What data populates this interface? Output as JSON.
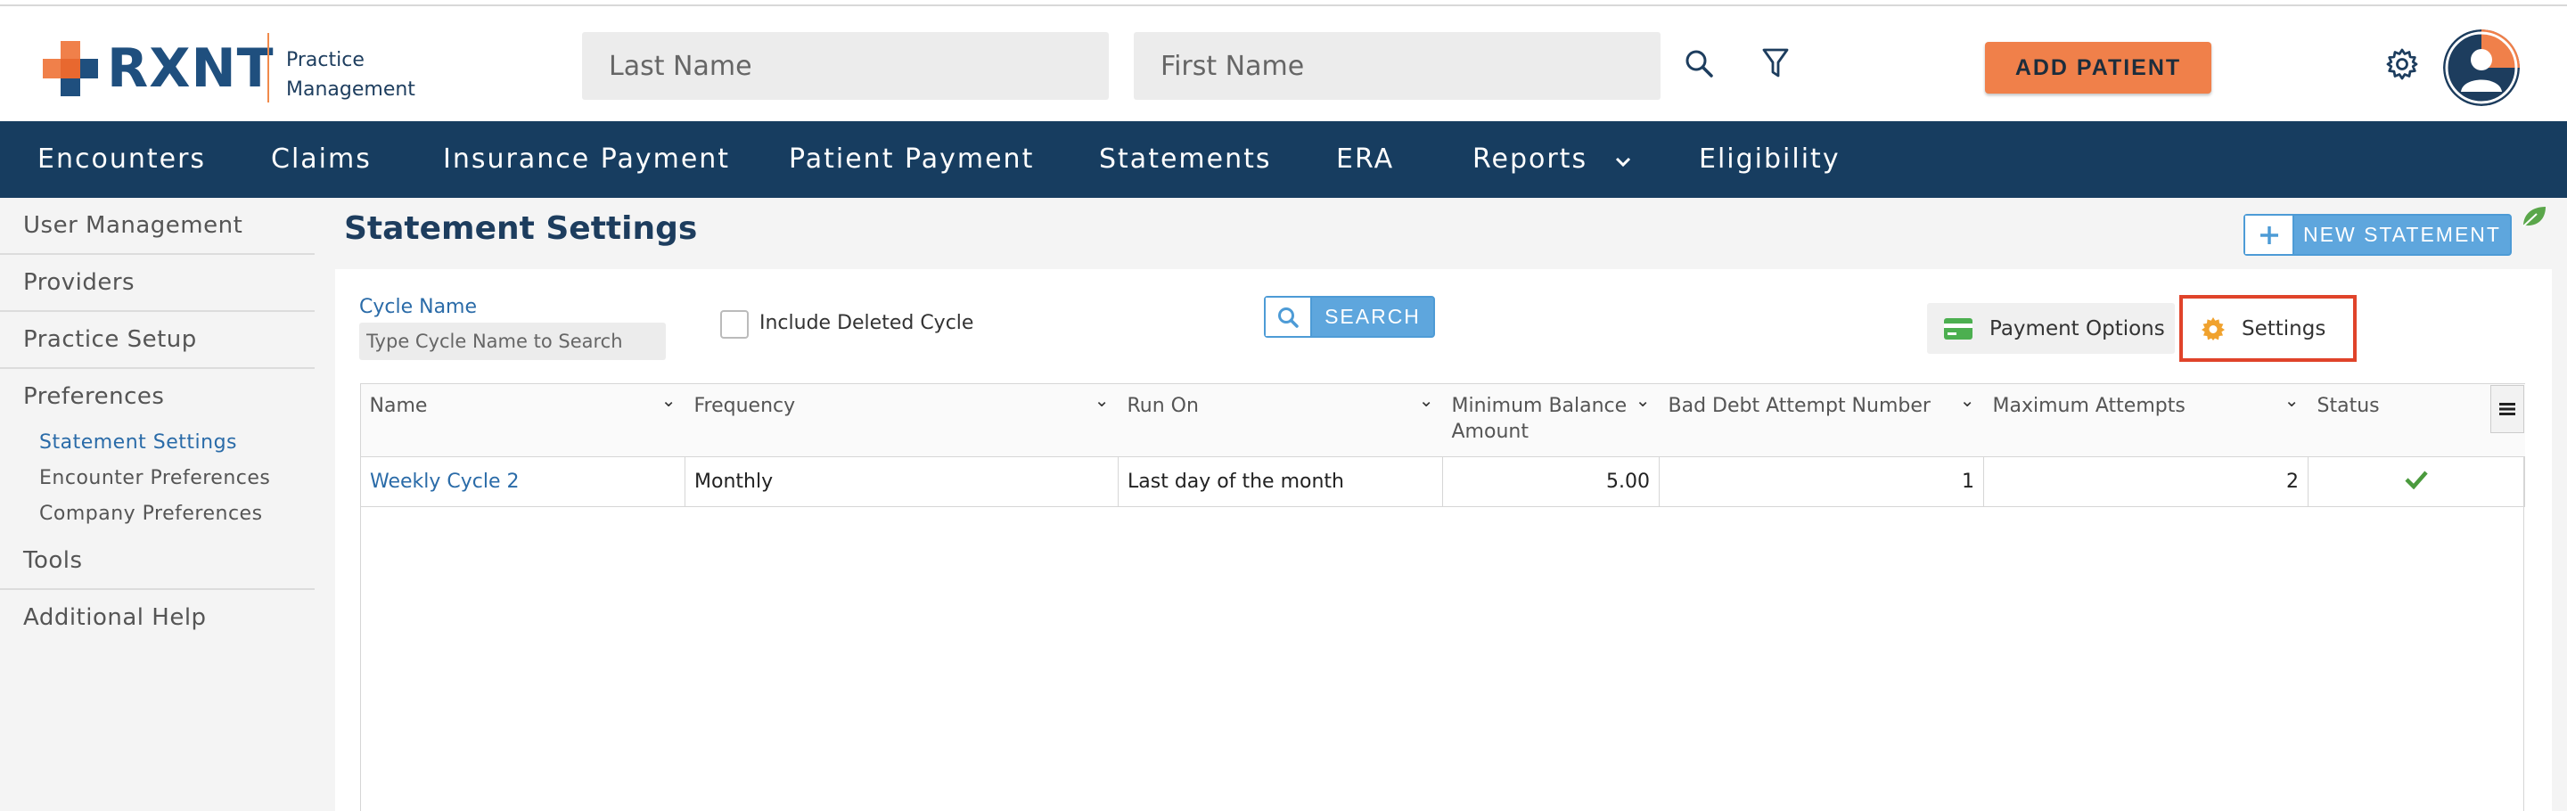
{
  "header": {
    "logo_text": "RXNT",
    "logo_sub_line1": "Practice",
    "logo_sub_line2": "Management",
    "last_name_placeholder": "Last Name",
    "first_name_placeholder": "First Name",
    "add_patient_label": "ADD PATIENT",
    "icons": [
      "search-icon",
      "filter-icon",
      "gear-icon",
      "avatar"
    ]
  },
  "nav": {
    "items": [
      {
        "label": "Encounters"
      },
      {
        "label": "Claims"
      },
      {
        "label": "Insurance Payment"
      },
      {
        "label": "Patient Payment"
      },
      {
        "label": "Statements"
      },
      {
        "label": "ERA"
      },
      {
        "label": "Reports"
      },
      {
        "label": "Eligibility"
      }
    ]
  },
  "sidebar": {
    "items": [
      {
        "label": "User Management"
      },
      {
        "label": "Providers"
      },
      {
        "label": "Practice Setup"
      },
      {
        "label": "Preferences"
      },
      {
        "label": "Tools"
      },
      {
        "label": "Additional Help"
      }
    ],
    "preferences_sub": [
      {
        "label": "Statement Settings",
        "active": true
      },
      {
        "label": "Encounter Preferences",
        "active": false
      },
      {
        "label": "Company Preferences",
        "active": false
      }
    ]
  },
  "main": {
    "title": "Statement Settings",
    "new_statement_label": "NEW STATEMENT",
    "cycle_name_label": "Cycle Name",
    "cycle_name_placeholder": "Type Cycle Name to Search",
    "include_deleted_label": "Include Deleted Cycle",
    "include_deleted_checked": false,
    "search_label": "SEARCH",
    "payment_options_label": "Payment Options",
    "settings_label": "Settings"
  },
  "table": {
    "columns": [
      "Name",
      "Frequency",
      "Run On",
      "Minimum Balance Amount",
      "Bad Debt Attempt Number",
      "Maximum Attempts",
      "Status"
    ],
    "rows": [
      {
        "name": "Weekly Cycle 2",
        "frequency": "Monthly",
        "run_on": "Last day of the month",
        "min_balance": "5.00",
        "bad_debt_attempt": "1",
        "max_attempts": "2",
        "status": "check-icon"
      }
    ]
  },
  "colors": {
    "nav_bg": "#173d60",
    "brand_blue": "#1f4f7e",
    "brand_orange": "#f0804a",
    "link_blue": "#2a6ba8",
    "button_blue": "#5ea6dd",
    "highlight_red": "#e0432a",
    "status_green": "#4a9a3d"
  }
}
